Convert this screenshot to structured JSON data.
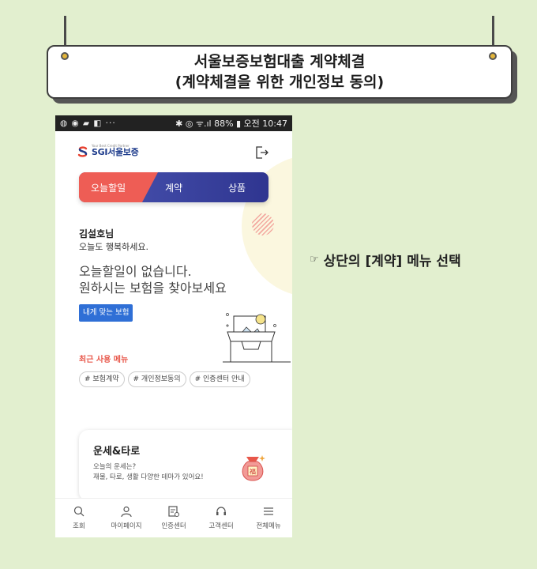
{
  "title_board": {
    "line1": "서울보증보험대출 계약체결",
    "line2": "(계약체결을 위한 개인정보 동의)"
  },
  "status_bar": {
    "left_icons": "◍ ◉ ▰ ◧ ···",
    "right": "✱ ◎ ᯤ.ıl 88% ▮ 오전 10:47"
  },
  "app": {
    "logo_text": "SGI서울보증",
    "logo_tagline": "Your Best Credit Partner",
    "tabs": [
      {
        "label": "오늘할일",
        "active": true
      },
      {
        "label": "계약",
        "active": false
      },
      {
        "label": "상품",
        "active": false
      }
    ],
    "greeting_name": "김설호님",
    "greeting_sub": "오늘도 행복하세요.",
    "message_line1": "오늘할일이 없습니다.",
    "message_line2": "원하시는 보험을 찾아보세요",
    "fit_button": "내게 맞는 보험",
    "recent_title": "최근 사용 메뉴",
    "recent_chips": [
      "# 보험계약",
      "# 개인정보동의",
      "# 인증센터 안내"
    ],
    "card": {
      "title": "운세&타로",
      "sub1": "오늘의 운세는?",
      "sub2": "재물, 타로, 생활 다양한 테마가 있어요!",
      "pouch_char": "福"
    },
    "bottom_nav": [
      {
        "label": "조회",
        "icon": "search-icon"
      },
      {
        "label": "마이페이지",
        "icon": "person-icon"
      },
      {
        "label": "인증센터",
        "icon": "certificate-icon"
      },
      {
        "label": "고객센터",
        "icon": "headset-icon"
      },
      {
        "label": "전체메뉴",
        "icon": "hamburger-menu-icon"
      }
    ]
  },
  "caption": {
    "hand": "☞",
    "text": "상단의 [계약] 메뉴 선택"
  },
  "colors": {
    "background": "#e2efcf",
    "tab_active": "#ee5d55",
    "tab_bar": "#3a42a0",
    "button_blue": "#2f6fd6",
    "recent_red": "#e8574a"
  }
}
